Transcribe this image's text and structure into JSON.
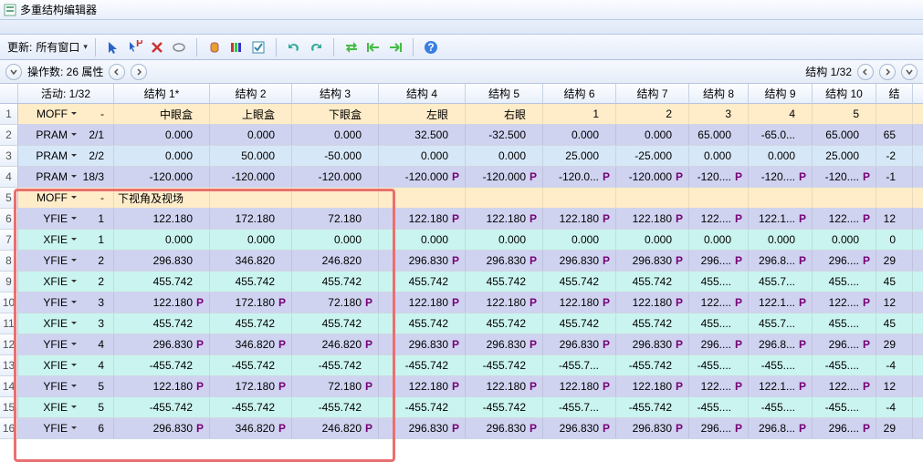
{
  "title": "多重结构编辑器",
  "toolbar": {
    "update_label": "更新:",
    "update_value": "所有窗口",
    "dropdown": "▾"
  },
  "status": {
    "left": "操作数: 26 属性",
    "right": "结构 1/32"
  },
  "cols": [
    {
      "w": 20,
      "label": ""
    },
    {
      "w": 105,
      "label": "活动: 1/32"
    },
    {
      "w": 105,
      "label": "结构 1*"
    },
    {
      "w": 90,
      "label": "结构 2"
    },
    {
      "w": 95,
      "label": "结构 3"
    },
    {
      "w": 95,
      "label": "结构 4"
    },
    {
      "w": 85,
      "label": "结构 5"
    },
    {
      "w": 80,
      "label": "结构 6"
    },
    {
      "w": 80,
      "label": "结构 7"
    },
    {
      "w": 65,
      "label": "结构 8"
    },
    {
      "w": 70,
      "label": "结构 9"
    },
    {
      "w": 70,
      "label": "结构 10"
    },
    {
      "w": 40,
      "label": "结"
    }
  ],
  "rows": [
    {
      "n": "1",
      "bg": "#ffecc9",
      "cmd": "MOFF",
      "sub": "-",
      "cells": [
        [
          "中眼盒",
          ""
        ],
        [
          "上眼盒",
          ""
        ],
        [
          "下眼盒",
          ""
        ],
        [
          "左眼",
          ""
        ],
        [
          "右眼",
          ""
        ],
        [
          "1",
          ""
        ],
        [
          "2",
          ""
        ],
        [
          "3",
          ""
        ],
        [
          "4",
          ""
        ],
        [
          "5",
          ""
        ],
        [
          "",
          ""
        ]
      ]
    },
    {
      "n": "2",
      "bg": "#cfd3f0",
      "cmd": "PRAM",
      "sub": "2/1",
      "cells": [
        [
          "0.000",
          ""
        ],
        [
          "0.000",
          ""
        ],
        [
          "0.000",
          ""
        ],
        [
          "32.500",
          ""
        ],
        [
          "-32.500",
          ""
        ],
        [
          "0.000",
          ""
        ],
        [
          "0.000",
          ""
        ],
        [
          "65.000",
          ""
        ],
        [
          "-65.0...",
          ""
        ],
        [
          "65.000",
          ""
        ],
        [
          "65",
          ""
        ]
      ]
    },
    {
      "n": "3",
      "bg": "#d6e7f7",
      "cmd": "PRAM",
      "sub": "2/2",
      "cells": [
        [
          "0.000",
          ""
        ],
        [
          "50.000",
          ""
        ],
        [
          "-50.000",
          ""
        ],
        [
          "0.000",
          ""
        ],
        [
          "0.000",
          ""
        ],
        [
          "25.000",
          ""
        ],
        [
          "-25.000",
          ""
        ],
        [
          "0.000",
          ""
        ],
        [
          "0.000",
          ""
        ],
        [
          "25.000",
          ""
        ],
        [
          "-2",
          ""
        ]
      ]
    },
    {
      "n": "4",
      "bg": "#cfd3f0",
      "cmd": "PRAM",
      "sub": "18/3",
      "cells": [
        [
          "-120.000",
          ""
        ],
        [
          "-120.000",
          ""
        ],
        [
          "-120.000",
          ""
        ],
        [
          "-120.000",
          "P"
        ],
        [
          "-120.000",
          "P"
        ],
        [
          "-120.0...",
          "P"
        ],
        [
          "-120.000",
          "P"
        ],
        [
          "-120....",
          "P"
        ],
        [
          "-120....",
          "P"
        ],
        [
          "-120....",
          "P"
        ],
        [
          "-1",
          ""
        ]
      ]
    },
    {
      "n": "5",
      "bg": "#ffecc9",
      "cmd": "MOFF",
      "sub": "-",
      "cells": [
        [
          "下视角及视场",
          "",
          true
        ],
        [
          "",
          ""
        ],
        [
          "",
          ""
        ],
        [
          "",
          ""
        ],
        [
          "",
          ""
        ],
        [
          "",
          ""
        ],
        [
          "",
          ""
        ],
        [
          "",
          ""
        ],
        [
          "",
          ""
        ],
        [
          "",
          ""
        ],
        [
          "",
          ""
        ]
      ]
    },
    {
      "n": "6",
      "bg": "#cfd3f0",
      "cmd": "YFIE",
      "sub": "1",
      "cells": [
        [
          "122.180",
          ""
        ],
        [
          "172.180",
          ""
        ],
        [
          "72.180",
          ""
        ],
        [
          "122.180",
          "P"
        ],
        [
          "122.180",
          "P"
        ],
        [
          "122.180",
          "P"
        ],
        [
          "122.180",
          "P"
        ],
        [
          "122....",
          "P"
        ],
        [
          "122.1...",
          "P"
        ],
        [
          "122....",
          "P"
        ],
        [
          "12",
          ""
        ]
      ]
    },
    {
      "n": "7",
      "bg": "#caf4ef",
      "cmd": "XFIE",
      "sub": "1",
      "cells": [
        [
          "0.000",
          ""
        ],
        [
          "0.000",
          ""
        ],
        [
          "0.000",
          ""
        ],
        [
          "0.000",
          ""
        ],
        [
          "0.000",
          ""
        ],
        [
          "0.000",
          ""
        ],
        [
          "0.000",
          ""
        ],
        [
          "0.000",
          ""
        ],
        [
          "0.000",
          ""
        ],
        [
          "0.000",
          ""
        ],
        [
          "0",
          ""
        ]
      ]
    },
    {
      "n": "8",
      "bg": "#cfd3f0",
      "cmd": "YFIE",
      "sub": "2",
      "cells": [
        [
          "296.830",
          ""
        ],
        [
          "346.820",
          ""
        ],
        [
          "246.820",
          ""
        ],
        [
          "296.830",
          "P"
        ],
        [
          "296.830",
          "P"
        ],
        [
          "296.830",
          "P"
        ],
        [
          "296.830",
          "P"
        ],
        [
          "296....",
          "P"
        ],
        [
          "296.8...",
          "P"
        ],
        [
          "296....",
          "P"
        ],
        [
          "29",
          ""
        ]
      ]
    },
    {
      "n": "9",
      "bg": "#caf4ef",
      "cmd": "XFIE",
      "sub": "2",
      "cells": [
        [
          "455.742",
          ""
        ],
        [
          "455.742",
          ""
        ],
        [
          "455.742",
          ""
        ],
        [
          "455.742",
          ""
        ],
        [
          "455.742",
          ""
        ],
        [
          "455.742",
          ""
        ],
        [
          "455.742",
          ""
        ],
        [
          "455....",
          ""
        ],
        [
          "455.7...",
          ""
        ],
        [
          "455....",
          ""
        ],
        [
          "45",
          ""
        ]
      ]
    },
    {
      "n": "10",
      "bg": "#cfd3f0",
      "cmd": "YFIE",
      "sub": "3",
      "cells": [
        [
          "122.180",
          "P"
        ],
        [
          "172.180",
          "P"
        ],
        [
          "72.180",
          "P"
        ],
        [
          "122.180",
          "P"
        ],
        [
          "122.180",
          "P"
        ],
        [
          "122.180",
          "P"
        ],
        [
          "122.180",
          "P"
        ],
        [
          "122....",
          "P"
        ],
        [
          "122.1...",
          "P"
        ],
        [
          "122....",
          "P"
        ],
        [
          "12",
          ""
        ]
      ]
    },
    {
      "n": "11",
      "bg": "#caf4ef",
      "cmd": "XFIE",
      "sub": "3",
      "cells": [
        [
          "455.742",
          ""
        ],
        [
          "455.742",
          ""
        ],
        [
          "455.742",
          ""
        ],
        [
          "455.742",
          ""
        ],
        [
          "455.742",
          ""
        ],
        [
          "455.742",
          ""
        ],
        [
          "455.742",
          ""
        ],
        [
          "455....",
          ""
        ],
        [
          "455.7...",
          ""
        ],
        [
          "455....",
          ""
        ],
        [
          "45",
          ""
        ]
      ]
    },
    {
      "n": "12",
      "bg": "#cfd3f0",
      "cmd": "YFIE",
      "sub": "4",
      "cells": [
        [
          "296.830",
          "P"
        ],
        [
          "346.820",
          "P"
        ],
        [
          "246.820",
          "P"
        ],
        [
          "296.830",
          "P"
        ],
        [
          "296.830",
          "P"
        ],
        [
          "296.830",
          "P"
        ],
        [
          "296.830",
          "P"
        ],
        [
          "296....",
          "P"
        ],
        [
          "296.8...",
          "P"
        ],
        [
          "296....",
          "P"
        ],
        [
          "29",
          ""
        ]
      ]
    },
    {
      "n": "13",
      "bg": "#caf4ef",
      "cmd": "XFIE",
      "sub": "4",
      "cells": [
        [
          "-455.742",
          ""
        ],
        [
          "-455.742",
          ""
        ],
        [
          "-455.742",
          ""
        ],
        [
          "-455.742",
          ""
        ],
        [
          "-455.742",
          ""
        ],
        [
          "-455.7...",
          ""
        ],
        [
          "-455.742",
          ""
        ],
        [
          "-455....",
          ""
        ],
        [
          "-455....",
          ""
        ],
        [
          "-455....",
          ""
        ],
        [
          "-4",
          ""
        ]
      ]
    },
    {
      "n": "14",
      "bg": "#cfd3f0",
      "cmd": "YFIE",
      "sub": "5",
      "cells": [
        [
          "122.180",
          "P"
        ],
        [
          "172.180",
          "P"
        ],
        [
          "72.180",
          "P"
        ],
        [
          "122.180",
          "P"
        ],
        [
          "122.180",
          "P"
        ],
        [
          "122.180",
          "P"
        ],
        [
          "122.180",
          "P"
        ],
        [
          "122....",
          "P"
        ],
        [
          "122.1...",
          "P"
        ],
        [
          "122....",
          "P"
        ],
        [
          "12",
          ""
        ]
      ]
    },
    {
      "n": "15",
      "bg": "#caf4ef",
      "cmd": "XFIE",
      "sub": "5",
      "cells": [
        [
          "-455.742",
          ""
        ],
        [
          "-455.742",
          ""
        ],
        [
          "-455.742",
          ""
        ],
        [
          "-455.742",
          ""
        ],
        [
          "-455.742",
          ""
        ],
        [
          "-455.7...",
          ""
        ],
        [
          "-455.742",
          ""
        ],
        [
          "-455....",
          ""
        ],
        [
          "-455....",
          ""
        ],
        [
          "-455....",
          ""
        ],
        [
          "-4",
          ""
        ]
      ]
    },
    {
      "n": "16",
      "bg": "#cfd3f0",
      "cmd": "YFIE",
      "sub": "6",
      "cells": [
        [
          "296.830",
          "P"
        ],
        [
          "346.820",
          "P"
        ],
        [
          "246.820",
          "P"
        ],
        [
          "296.830",
          "P"
        ],
        [
          "296.830",
          "P"
        ],
        [
          "296.830",
          "P"
        ],
        [
          "296.830",
          "P"
        ],
        [
          "296....",
          "P"
        ],
        [
          "296.8...",
          "P"
        ],
        [
          "296....",
          "P"
        ],
        [
          "29",
          ""
        ]
      ]
    }
  ]
}
